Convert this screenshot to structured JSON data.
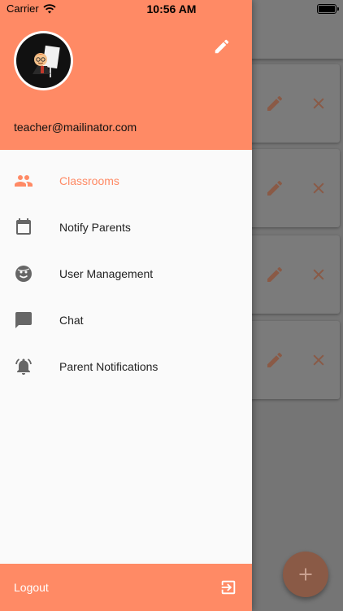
{
  "status_bar": {
    "carrier": "Carrier",
    "time": "10:56 AM",
    "wifi_icon": "wifi-icon",
    "battery_icon": "battery-icon"
  },
  "drawer": {
    "header": {
      "avatar_icon": "cartoon-teacher-avatar",
      "edit_icon": "pencil-icon",
      "email": "teacher@mailinator.com",
      "background_color": "#ff8a65"
    },
    "menu": [
      {
        "label": "Classrooms",
        "icon": "people-icon",
        "active": true
      },
      {
        "label": "Notify Parents",
        "icon": "calendar-icon",
        "active": false
      },
      {
        "label": "User Management",
        "icon": "face-icon",
        "active": false
      },
      {
        "label": "Chat",
        "icon": "chat-bubble-icon",
        "active": false
      },
      {
        "label": "Parent Notifications",
        "icon": "bell-ringing-icon",
        "active": false
      }
    ],
    "footer": {
      "logout_label": "Logout",
      "logout_icon": "exit-icon"
    }
  },
  "background_app": {
    "card_count": 4,
    "card_edit_icon": "pencil-icon",
    "card_delete_icon": "close-icon",
    "fab_icon": "plus-icon",
    "accent_color": "#8a5a46"
  }
}
